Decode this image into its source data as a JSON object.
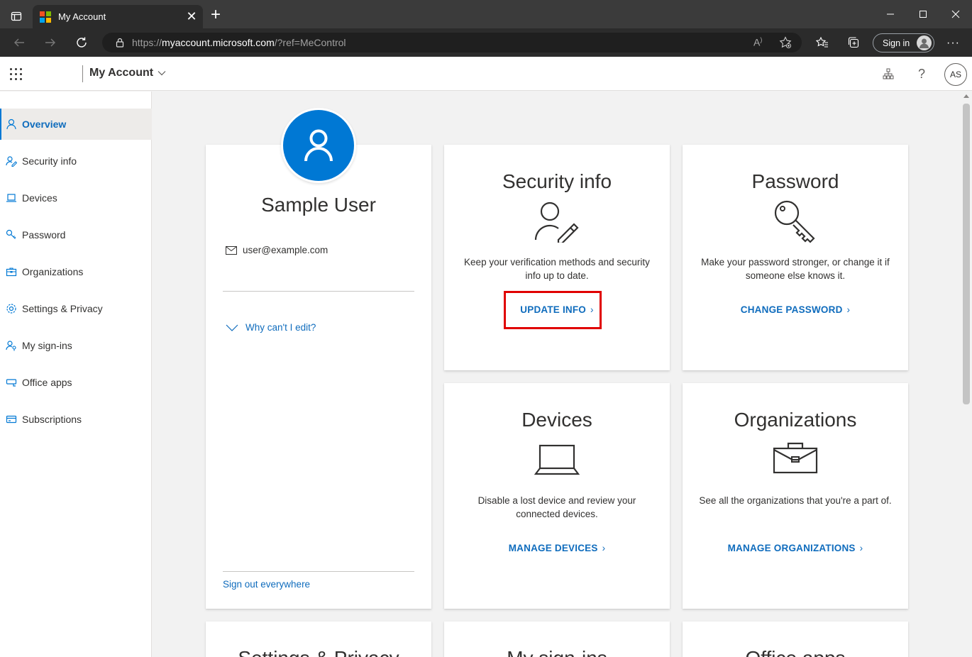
{
  "browser": {
    "tab_title": "My Account",
    "url_prefix": "https://",
    "url_domain": "myaccount.microsoft.com",
    "url_suffix": "/?ref=MeControl",
    "signin_label": "Sign in"
  },
  "header": {
    "app_title": "My Account",
    "avatar_initials": "AS"
  },
  "sidebar": {
    "items": [
      {
        "label": "Overview",
        "icon": "person-icon",
        "active": true
      },
      {
        "label": "Security info",
        "icon": "person-key-icon"
      },
      {
        "label": "Devices",
        "icon": "laptop-icon"
      },
      {
        "label": "Password",
        "icon": "key-icon"
      },
      {
        "label": "Organizations",
        "icon": "briefcase-icon"
      },
      {
        "label": "Settings & Privacy",
        "icon": "gear-icon"
      },
      {
        "label": "My sign-ins",
        "icon": "person-key-icon"
      },
      {
        "label": "Office apps",
        "icon": "office-icon"
      },
      {
        "label": "Subscriptions",
        "icon": "card-icon"
      }
    ]
  },
  "profile": {
    "name": "Sample User",
    "email": "user@example.com",
    "why_edit": "Why can't I edit?",
    "sign_out": "Sign out everywhere"
  },
  "cards": {
    "security": {
      "title": "Security info",
      "desc": "Keep your verification methods and security info up to date.",
      "link": "UPDATE INFO"
    },
    "password": {
      "title": "Password",
      "desc": "Make your password stronger, or change it if someone else knows it.",
      "link": "CHANGE PASSWORD"
    },
    "devices": {
      "title": "Devices",
      "desc": "Disable a lost device and review your connected devices.",
      "link": "MANAGE DEVICES"
    },
    "organizations": {
      "title": "Organizations",
      "desc": "See all the organizations that you're a part of.",
      "link": "MANAGE ORGANIZATIONS"
    },
    "bottom": {
      "settings_title": "Settings & Privacy",
      "signins_title": "My sign-ins",
      "office_title": "Office apps"
    }
  },
  "colors": {
    "accent": "#0078d4",
    "link": "#0f6cbd",
    "highlight": "#e00000"
  }
}
